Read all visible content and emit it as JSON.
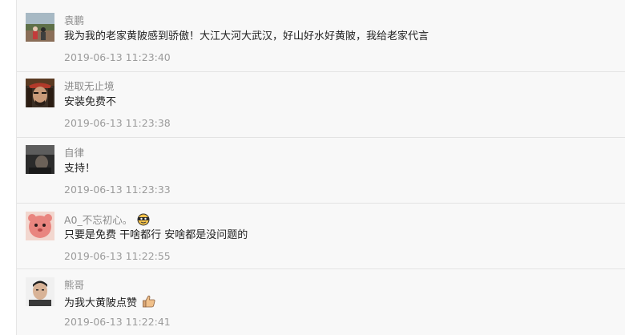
{
  "comments": [
    {
      "name": "袁鹏",
      "text": "我为我的老家黄陂感到骄傲！大江大河大武汉，好山好水好黄陂，我给老家代言",
      "time": "2019-06-13 11:23:40"
    },
    {
      "name": "进取无止境",
      "text": "安装免费不",
      "time": "2019-06-13 11:23:38"
    },
    {
      "name": "自律",
      "text": "支持！",
      "time": "2019-06-13 11:23:33"
    },
    {
      "name": "A0_不忘初心。",
      "text": "只要是免费 干啥都行 安啥都是没问题的",
      "time": "2019-06-13 11:22:55"
    },
    {
      "name": "熊哥",
      "text": "为我大黄陂点赞",
      "time": "2019-06-13 11:22:41"
    }
  ],
  "icons": {
    "name_badge": "ninja-emoji-icon",
    "thumbs_up": "thumbs-up-emoji-icon"
  }
}
